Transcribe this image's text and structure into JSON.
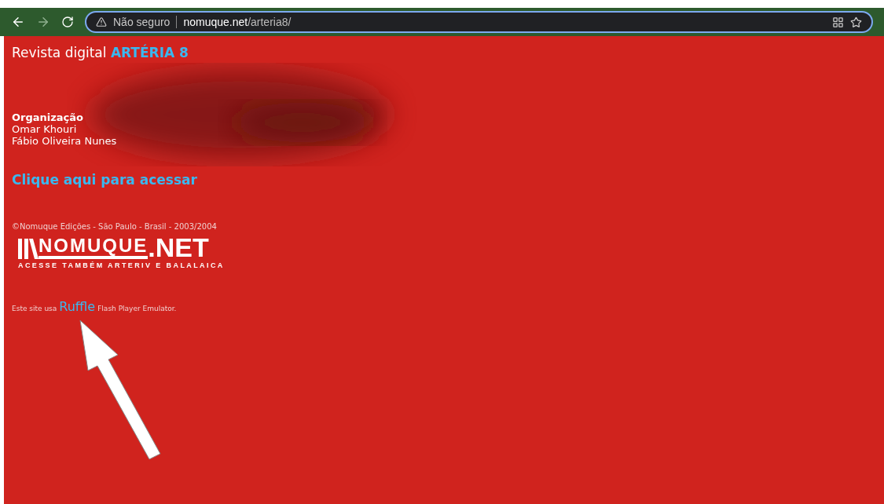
{
  "browser": {
    "security_label": "Não seguro",
    "url_host": "nomuque.net",
    "url_path": "/arteria8/"
  },
  "page": {
    "title_prefix": "Revista digital",
    "title_highlight": "ARTÉRIA 8",
    "organization_heading": "Organização",
    "organizers": [
      "Omar Khouri",
      "Fábio Oliveira Nunes"
    ],
    "access_link": "Clique aqui para acessar",
    "copyright": "©Nomuque Edições - São Paulo - Brasil - 2003/2004",
    "logo": {
      "mark": "NOMUQUE",
      "suffix": ".NET",
      "tagline": "ACESSE TAMBÉM ARTERIV E BALALAICA"
    },
    "ruffle_note": {
      "before": "Este site usa",
      "link": "Ruffle",
      "after": "Flash Player Emulator."
    }
  }
}
